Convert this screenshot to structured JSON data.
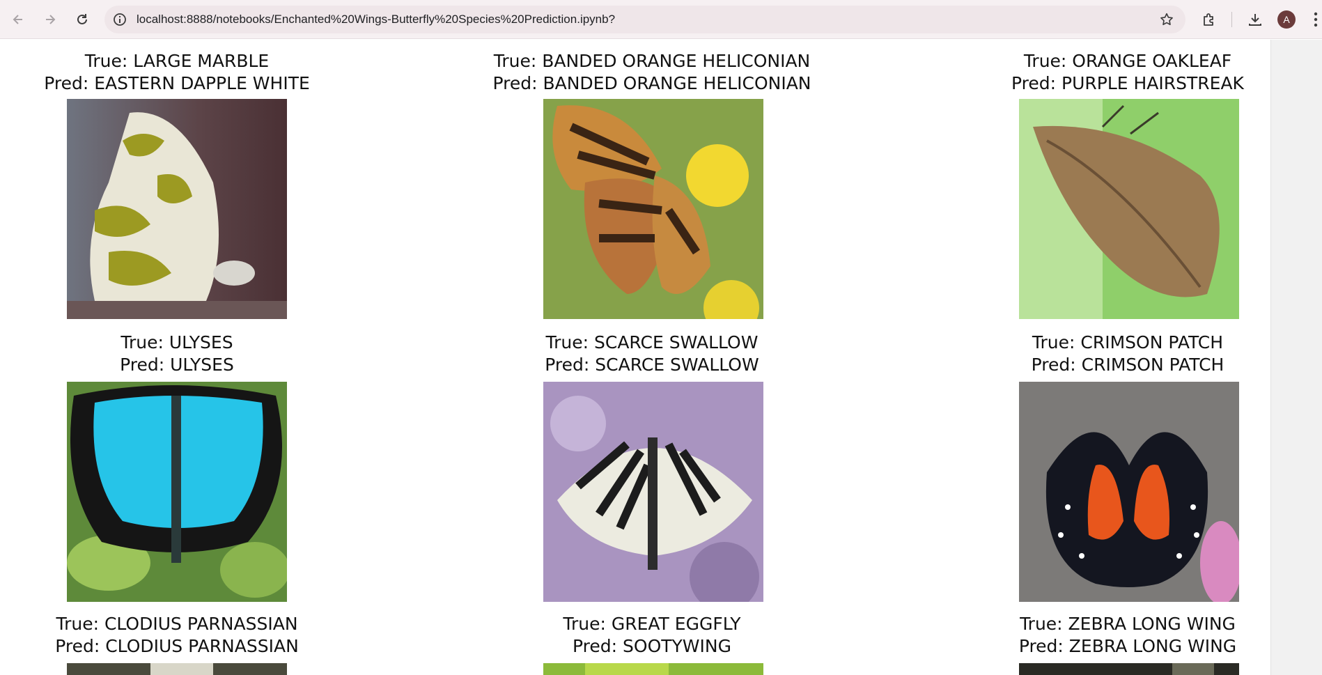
{
  "browser": {
    "url": "localhost:8888/notebooks/Enchanted%20Wings-Butterfly%20Species%20Prediction.ipynb?",
    "profile_initial": "A",
    "icons": [
      "back-arrow-icon",
      "forward-arrow-icon",
      "reload-icon",
      "site-info-icon",
      "star-icon",
      "extensions-icon",
      "download-icon",
      "more-menu-icon"
    ]
  },
  "predictions": [
    {
      "true_label": "True: LARGE MARBLE",
      "pred_label": "Pred: EASTERN DAPPLE WHITE",
      "image": "butterfly-photo"
    },
    {
      "true_label": "True: BANDED ORANGE HELICONIAN",
      "pred_label": "Pred: BANDED ORANGE HELICONIAN",
      "image": "butterfly-photo"
    },
    {
      "true_label": "True: ORANGE OAKLEAF",
      "pred_label": "Pred: PURPLE HAIRSTREAK",
      "image": "butterfly-photo"
    },
    {
      "true_label": "True: ULYSES",
      "pred_label": "Pred: ULYSES",
      "image": "butterfly-photo"
    },
    {
      "true_label": "True: SCARCE SWALLOW",
      "pred_label": "Pred: SCARCE SWALLOW",
      "image": "butterfly-photo"
    },
    {
      "true_label": "True: CRIMSON PATCH",
      "pred_label": "Pred: CRIMSON PATCH",
      "image": "butterfly-photo"
    },
    {
      "true_label": "True: CLODIUS PARNASSIAN",
      "pred_label": "Pred: CLODIUS PARNASSIAN",
      "image": "butterfly-photo"
    },
    {
      "true_label": "True: GREAT EGGFLY",
      "pred_label": "Pred: SOOTYWING",
      "image": "butterfly-photo"
    },
    {
      "true_label": "True: ZEBRA LONG WING",
      "pred_label": "Pred: ZEBRA LONG WING",
      "image": "butterfly-photo"
    }
  ]
}
